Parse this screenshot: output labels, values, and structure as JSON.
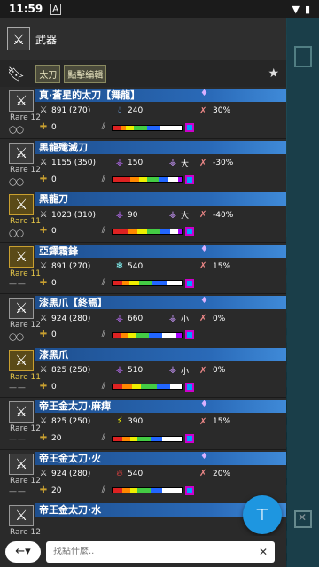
{
  "status": {
    "time": "11:59",
    "app_badge": "A",
    "wifi": "▼",
    "battery": "▮"
  },
  "header": {
    "title": "武器",
    "icon": "sword-icon"
  },
  "filters": {
    "tags": [
      "太刀",
      "點擊編輯"
    ]
  },
  "search": {
    "placeholder": "找點什麼.."
  },
  "colors": {
    "name_bar": "#2a6ab8",
    "fab": "#1e96e0"
  },
  "weapons": [
    {
      "name": "真·蒼星的太刀【舞龍】",
      "rare": "Rare 12",
      "attack": "891 (270)",
      "element_icon": "water",
      "element": "240",
      "elderseal": "",
      "affinity": "30%",
      "defense": "0",
      "gold": false,
      "slot_icons": "〇〇",
      "augment": "♦",
      "sharp": [
        [
          "#d22",
          8
        ],
        [
          "#f80",
          6
        ],
        [
          "#ee0",
          8
        ],
        [
          "#4c4",
          14
        ],
        [
          "#26f",
          14
        ],
        [
          "#fff",
          22
        ],
        [
          "#a0f",
          0
        ]
      ]
    },
    {
      "name": "黑龍殲滅刀",
      "rare": "Rare 12",
      "attack": "1155 (350)",
      "element_icon": "dragon",
      "element": "150",
      "elderseal": "大",
      "affinity": "-30%",
      "defense": "0",
      "gold": false,
      "slot_icons": "〇〇",
      "augment": "",
      "sharp": [
        [
          "#d22",
          18
        ],
        [
          "#f80",
          10
        ],
        [
          "#ee0",
          8
        ],
        [
          "#4c4",
          12
        ],
        [
          "#26f",
          10
        ],
        [
          "#fff",
          10
        ],
        [
          "#a0f",
          4
        ]
      ]
    },
    {
      "name": "黑龍刀",
      "rare": "Rare 11",
      "attack": "1023 (310)",
      "element_icon": "dragon",
      "element": "90",
      "elderseal": "大",
      "affinity": "-40%",
      "defense": "0",
      "gold": true,
      "slot_icons": "〇〇",
      "augment": "",
      "sharp": [
        [
          "#d22",
          16
        ],
        [
          "#f80",
          10
        ],
        [
          "#ee0",
          10
        ],
        [
          "#4c4",
          14
        ],
        [
          "#26f",
          10
        ],
        [
          "#fff",
          8
        ],
        [
          "#a0f",
          4
        ]
      ]
    },
    {
      "name": "亞鐸霜鋒",
      "rare": "Rare 11",
      "attack": "891 (270)",
      "element_icon": "ice",
      "element": "540",
      "elderseal": "",
      "affinity": "15%",
      "defense": "0",
      "gold": true,
      "slot_icons": "— —",
      "augment": "♦",
      "sharp": [
        [
          "#d22",
          10
        ],
        [
          "#f80",
          8
        ],
        [
          "#ee0",
          10
        ],
        [
          "#4c4",
          14
        ],
        [
          "#26f",
          16
        ],
        [
          "#fff",
          16
        ],
        [
          "#a0f",
          0
        ]
      ]
    },
    {
      "name": "漆黑爪【終焉】",
      "rare": "Rare 12",
      "attack": "924 (280)",
      "element_icon": "dragon",
      "element": "660",
      "elderseal": "小",
      "affinity": "0%",
      "defense": "0",
      "gold": false,
      "slot_icons": "〇〇",
      "augment": "♦",
      "sharp": [
        [
          "#d22",
          8
        ],
        [
          "#f80",
          8
        ],
        [
          "#ee0",
          8
        ],
        [
          "#4c4",
          14
        ],
        [
          "#26f",
          14
        ],
        [
          "#fff",
          14
        ],
        [
          "#a0f",
          6
        ]
      ]
    },
    {
      "name": "漆黑爪",
      "rare": "Rare 11",
      "attack": "825 (250)",
      "element_icon": "dragon",
      "element": "510",
      "elderseal": "小",
      "affinity": "0%",
      "defense": "0",
      "gold": true,
      "slot_icons": "— —",
      "augment": "",
      "sharp": [
        [
          "#d22",
          10
        ],
        [
          "#f80",
          10
        ],
        [
          "#ee0",
          10
        ],
        [
          "#4c4",
          16
        ],
        [
          "#26f",
          14
        ],
        [
          "#fff",
          12
        ],
        [
          "#a0f",
          0
        ]
      ]
    },
    {
      "name": "帝王金太刀·麻痺",
      "rare": "Rare 12",
      "attack": "825 (250)",
      "element_icon": "paralysis",
      "element": "390",
      "elderseal": "",
      "affinity": "15%",
      "defense": "20",
      "gold": false,
      "slot_icons": "— —",
      "augment": "♦",
      "sharp": [
        [
          "#d22",
          10
        ],
        [
          "#f80",
          8
        ],
        [
          "#ee0",
          8
        ],
        [
          "#4c4",
          14
        ],
        [
          "#26f",
          12
        ],
        [
          "#fff",
          20
        ],
        [
          "#a0f",
          0
        ]
      ]
    },
    {
      "name": "帝王金太刀·火",
      "rare": "Rare 12",
      "attack": "924 (280)",
      "element_icon": "fire",
      "element": "540",
      "elderseal": "",
      "affinity": "20%",
      "defense": "20",
      "gold": false,
      "slot_icons": "— —",
      "augment": "♦",
      "sharp": [
        [
          "#d22",
          10
        ],
        [
          "#f80",
          8
        ],
        [
          "#ee0",
          8
        ],
        [
          "#4c4",
          14
        ],
        [
          "#26f",
          12
        ],
        [
          "#fff",
          20
        ],
        [
          "#a0f",
          0
        ]
      ]
    },
    {
      "name": "帝王金太刀·水",
      "rare": "Rare 12",
      "attack": "",
      "element_icon": "water",
      "element": "",
      "elderseal": "",
      "affinity": "",
      "defense": "",
      "gold": false,
      "slot_icons": "",
      "augment": "",
      "sharp": []
    }
  ]
}
